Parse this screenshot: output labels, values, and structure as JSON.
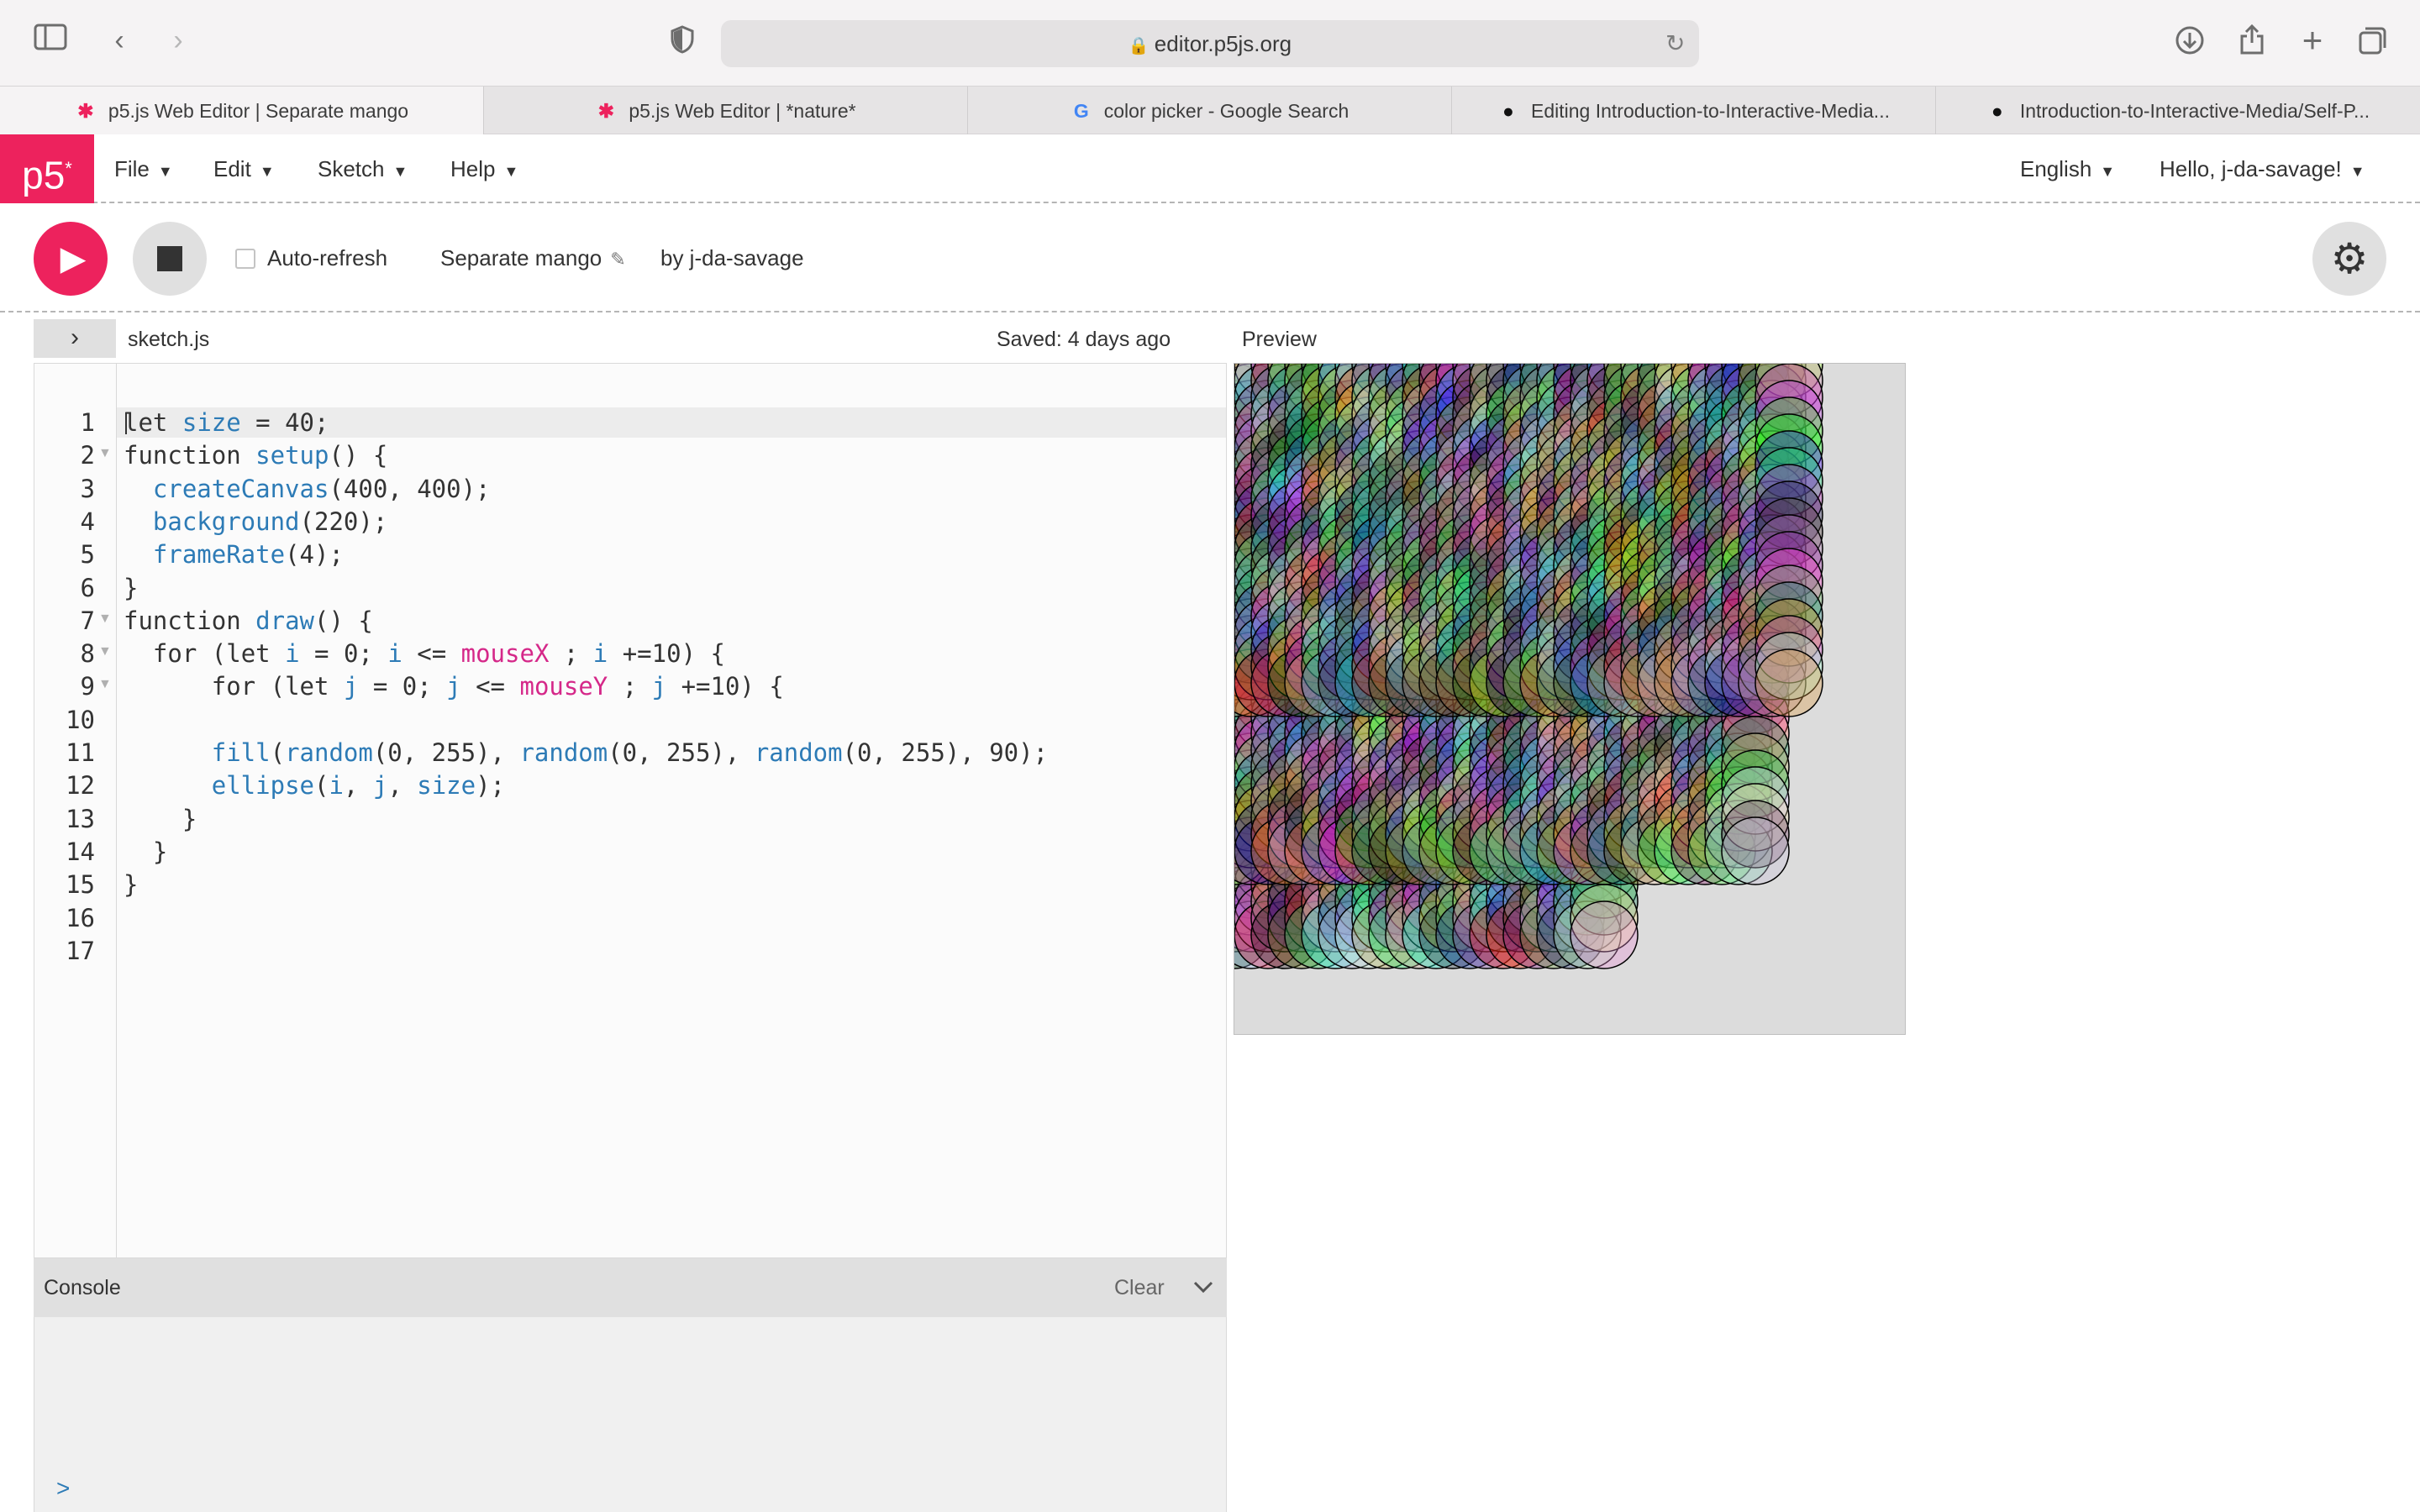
{
  "browser": {
    "url": "editor.p5js.org",
    "tabs": [
      {
        "label": "p5.js Web Editor | Separate mango",
        "icon": "p5-asterisk-icon",
        "active": true
      },
      {
        "label": "p5.js Web Editor | *nature*",
        "icon": "p5-asterisk-icon",
        "active": false
      },
      {
        "label": "color picker - Google Search",
        "icon": "google-icon",
        "active": false
      },
      {
        "label": "Editing Introduction-to-Interactive-Media...",
        "icon": "github-icon",
        "active": false
      },
      {
        "label": "Introduction-to-Interactive-Media/Self-P...",
        "icon": "github-icon",
        "active": false
      }
    ]
  },
  "nav": {
    "logo": "p5",
    "logo_sup": "*",
    "menus": [
      "File",
      "Edit",
      "Sketch",
      "Help"
    ],
    "language": "English",
    "user_greeting": "Hello, j-da-savage!"
  },
  "sketch": {
    "auto_refresh_label": "Auto-refresh",
    "auto_refresh_checked": false,
    "name": "Separate mango",
    "author": "by j-da-savage"
  },
  "editor": {
    "filename": "sketch.js",
    "saved_status": "Saved: 4 days ago",
    "preview_label": "Preview",
    "code_lines": [
      "let size = 40;",
      "function setup() {",
      "  createCanvas(400, 400);",
      "  background(220);",
      "  frameRate(4);",
      "}",
      "function draw() {",
      "  for (let i = 0; i <= mouseX ; i +=10) {",
      "      for (let j = 0; j <= mouseY ; j +=10) {",
      "",
      "      fill(random(0, 255), random(0, 255), random(0, 255), 90);",
      "      ellipse(i, j, size);",
      "    }",
      "  }",
      "}",
      "",
      ""
    ],
    "fold_lines": [
      2,
      7,
      8,
      9
    ]
  },
  "console": {
    "title": "Console",
    "clear_label": "Clear",
    "prompt": ">"
  },
  "colors": {
    "accent": "#ed225d",
    "keyword": "#333333",
    "function": "#2d7bb6",
    "variable_pink": "#d52889",
    "number": "#333333"
  }
}
